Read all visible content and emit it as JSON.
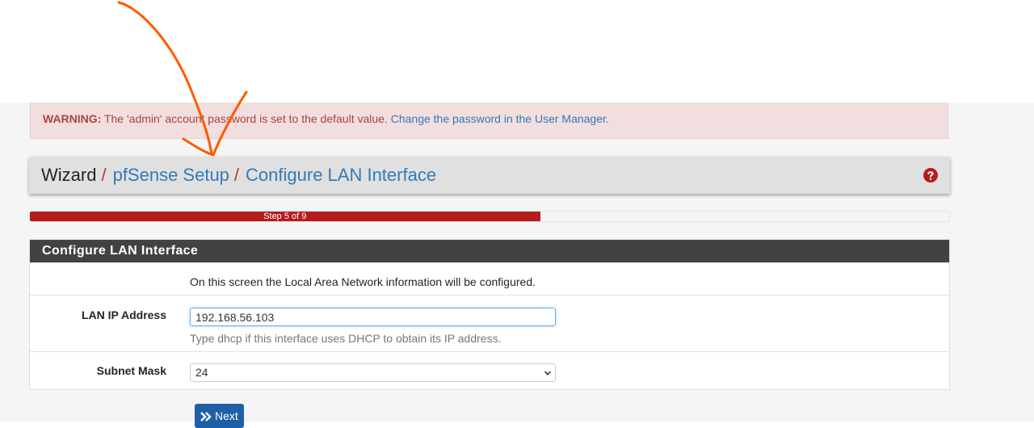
{
  "alert": {
    "strong": "WARNING:",
    "message": "The 'admin' account password is set to the default value.",
    "link": "Change the password in the User Manager."
  },
  "breadcrumb": {
    "root": "Wizard",
    "sep": "/",
    "level1": "pfSense Setup",
    "level2": "Configure LAN Interface"
  },
  "progress": {
    "label": "Step 5 of 9",
    "fraction": 0.555
  },
  "panel": {
    "title": "Configure LAN Interface",
    "intro": "On this screen the Local Area Network information will be configured.",
    "lan_ip": {
      "label": "LAN IP Address",
      "value": "192.168.56.103",
      "help": "Type dhcp if this interface uses DHCP to obtain its IP address."
    },
    "subnet": {
      "label": "Subnet Mask",
      "value": "24"
    }
  },
  "next_button": {
    "label": "Next"
  },
  "colors": {
    "accent": "#337ab7",
    "danger": "#b71c1c",
    "annotation": "#ff5a00"
  }
}
